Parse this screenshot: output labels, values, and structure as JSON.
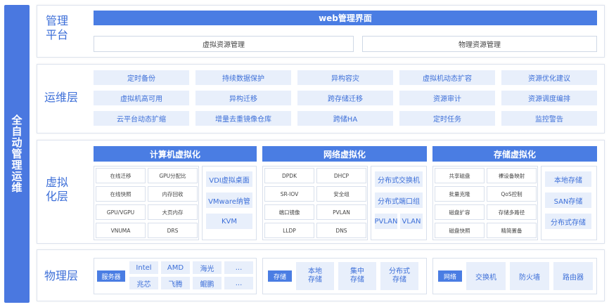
{
  "side_title": "全自动管理运维",
  "mgmt": {
    "title_l1": "管理",
    "title_l2": "平台",
    "web_bar": "web管理界面",
    "virtual_mgmt": "虚拟资源管理",
    "physical_mgmt": "物理资源管理"
  },
  "ops": {
    "title": "运维层",
    "rows": [
      [
        "定时备份",
        "持续数据保护",
        "异构容灾",
        "虚拟机动态扩容",
        "资源优化建议"
      ],
      [
        "虚拟机高可用",
        "异构迁移",
        "跨存储迁移",
        "资源审计",
        "资源调度编排"
      ],
      [
        "云平台动态扩缩",
        "增量去重镜像仓库",
        "跨储HA",
        "定时任务",
        "监控警告"
      ]
    ]
  },
  "virt": {
    "title_l1": "虚拟",
    "title_l2": "化层",
    "compute": {
      "header": "计算机虚拟化",
      "grid": [
        "在线迁移",
        "GPU分配比",
        "在线快照",
        "内存回收",
        "GPU/VGPU",
        "大页内存",
        "VNUMA",
        "DRS"
      ],
      "side": [
        "VDI虚拟桌面",
        "VMware纳管",
        "KVM"
      ]
    },
    "network": {
      "header": "网络虚拟化",
      "grid": [
        "DPDK",
        "DHCP",
        "SR-IOV",
        "安全组",
        "端口镜像",
        "PVLAN",
        "LLDP",
        "DNS"
      ],
      "side": [
        "分布式交换机",
        "分布式端口组"
      ],
      "side_pair": [
        "PVLAN",
        "VLAN"
      ]
    },
    "storage": {
      "header": "存储虚拟化",
      "grid": [
        "共享磁盘",
        "裸设备映射",
        "批量克隆",
        "QoS控制",
        "磁盘扩容",
        "存储多路径",
        "磁盘快照",
        "精简置备"
      ],
      "side": [
        "本地存储",
        "SAN存储",
        "分布式存储"
      ]
    }
  },
  "phys": {
    "title": "物理层",
    "server_tag": "服务器",
    "servers": [
      "Intel",
      "AMD",
      "海光",
      "...",
      "兆芯",
      "飞腾",
      "鲲鹏",
      "..."
    ],
    "storage_tag": "存储",
    "storage_items": [
      [
        "本地",
        "存储"
      ],
      [
        "集中",
        "存储"
      ],
      [
        "分布式",
        "存储"
      ]
    ],
    "network_tag": "网络",
    "network_items": [
      "交换机",
      "防火墙",
      "路由器"
    ]
  }
}
